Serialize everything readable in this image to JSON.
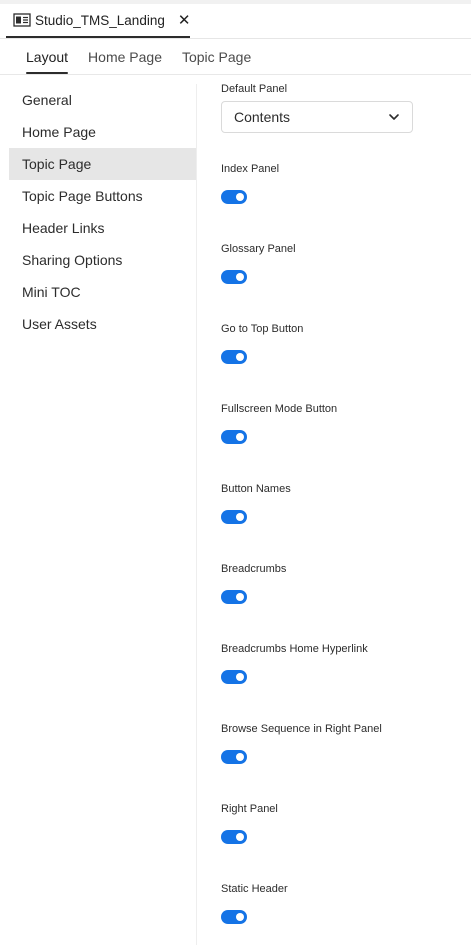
{
  "document_tab": {
    "title": "Studio_TMS_Landing",
    "close_symbol": "✕"
  },
  "subtabs": [
    {
      "label": "Layout",
      "active": true
    },
    {
      "label": "Home Page",
      "active": false
    },
    {
      "label": "Topic Page",
      "active": false
    }
  ],
  "sidebar": {
    "items": [
      {
        "label": "General",
        "selected": false
      },
      {
        "label": "Home Page",
        "selected": false
      },
      {
        "label": "Topic Page",
        "selected": true
      },
      {
        "label": "Topic Page Buttons",
        "selected": false
      },
      {
        "label": "Header Links",
        "selected": false
      },
      {
        "label": "Sharing Options",
        "selected": false
      },
      {
        "label": "Mini TOC",
        "selected": false
      },
      {
        "label": "User Assets",
        "selected": false
      }
    ]
  },
  "settings": {
    "default_panel": {
      "label": "Default Panel",
      "value": "Contents"
    },
    "toggles": [
      {
        "label": "Index Panel",
        "on": true
      },
      {
        "label": "Glossary Panel",
        "on": true
      },
      {
        "label": "Go to Top Button",
        "on": true
      },
      {
        "label": "Fullscreen Mode Button",
        "on": true
      },
      {
        "label": "Button Names",
        "on": true
      },
      {
        "label": "Breadcrumbs",
        "on": true
      },
      {
        "label": "Breadcrumbs Home Hyperlink",
        "on": true
      },
      {
        "label": "Browse Sequence in Right Panel",
        "on": true
      },
      {
        "label": "Right Panel",
        "on": true
      },
      {
        "label": "Static Header",
        "on": true
      }
    ]
  },
  "colors": {
    "accent": "#1473e6",
    "selected_bg": "#e6e6e6",
    "text": "#2c2c2c"
  }
}
